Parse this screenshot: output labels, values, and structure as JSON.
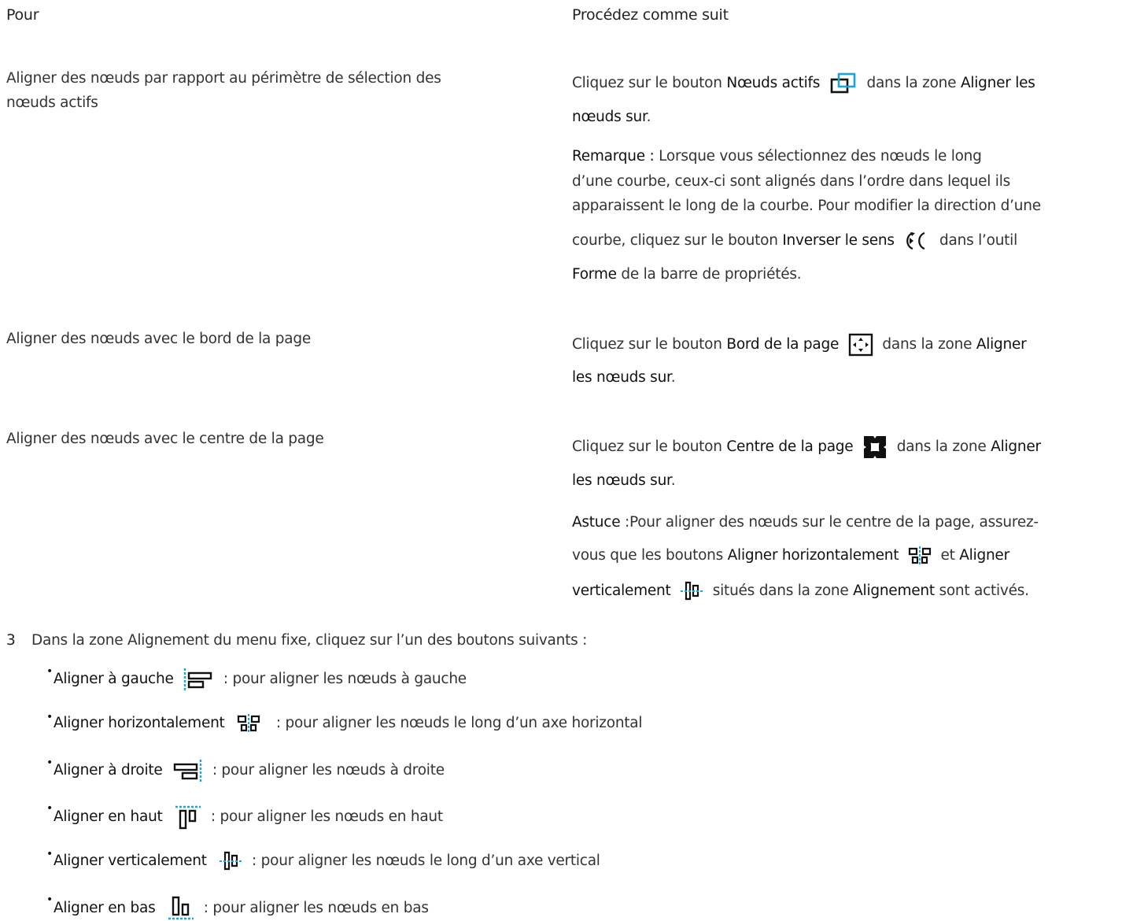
{
  "table": {
    "header_left": "Pour",
    "header_right": "Procédez comme suit",
    "rows": [
      {
        "left_line1": "Aligner des nœuds par rapport au périmètre de sélection des",
        "left_line2": "nœuds actifs",
        "r_click": "Cliquez sur le bouton",
        "r_btn": "Nœuds actifs",
        "r_icon": "active-nodes-icon",
        "r_zone": "dans la zone",
        "r_zone_name_a": "Aligner les",
        "r_zone_name_b": "nœuds sur",
        "r_end": ".",
        "note_label": "Remarque :",
        "note_line1": "Lorsque vous sélectionnez des nœuds le long",
        "note_line2": "d’une courbe, ceux-ci sont alignés dans l’ordre dans lequel ils",
        "note_line3": "apparaissent le long de la courbe. Pour modifier la direction d’une",
        "note_line4a": "courbe, cliquez sur le bouton",
        "note_btn": "Inverser le sens",
        "note_icon": "reverse-direction-icon",
        "note_line4b": "dans l’outil",
        "note_tool": "Forme",
        "note_line5": "de la barre de propriétés."
      },
      {
        "left": "Aligner des nœuds avec le bord de la page",
        "r_click": "Cliquez sur le bouton",
        "r_btn": "Bord de la page",
        "r_icon": "page-edge-icon",
        "r_zone": "dans la zone",
        "r_zone_name_a": "Aligner",
        "r_zone_name_b": "les nœuds sur",
        "r_end": "."
      },
      {
        "left": "Aligner des nœuds avec le centre de la page",
        "r_click": "Cliquez sur le bouton",
        "r_btn": "Centre de la page",
        "r_icon": "page-center-icon",
        "r_zone": "dans la zone",
        "r_zone_name_a": "Aligner",
        "r_zone_name_b": "les nœuds sur",
        "r_end": ".",
        "tip_label": "Astuce",
        "tip_colon": ":",
        "tip_line1": "Pour aligner des nœuds sur le centre de la page, assurez-",
        "tip_line2a": "vous que les boutons",
        "tip_btn1": "Aligner horizontalement",
        "tip_and": "et",
        "tip_btn2a": "Aligner",
        "tip_btn2b": "verticalement",
        "tip_line3a": "situés dans la zone",
        "tip_zone": "Alignement",
        "tip_line3b": "sont activés."
      }
    ]
  },
  "step": {
    "number": "3",
    "text": "Dans la zone Alignement du menu fixe, cliquez sur l’un des boutons suivants :"
  },
  "bullets": [
    {
      "label": "Aligner à gauche",
      "icon": "align-left-icon",
      "desc": ": pour aligner les nœuds à gauche"
    },
    {
      "label": "Aligner horizontalement",
      "icon": "align-horizontal-center-icon",
      "desc": ": pour aligner les nœuds le long d’un axe horizontal"
    },
    {
      "label": "Aligner à droite",
      "icon": "align-right-icon",
      "desc": ": pour aligner les nœuds à droite"
    },
    {
      "label": "Aligner en haut",
      "icon": "align-top-icon",
      "desc": ": pour aligner les nœuds en haut"
    },
    {
      "label": "Aligner verticalement",
      "icon": "align-vertical-center-icon",
      "desc": ": pour aligner les nœuds le long d’un axe vertical"
    },
    {
      "label": "Aligner en bas",
      "icon": "align-bottom-icon",
      "desc": ": pour aligner les nœuds en bas"
    }
  ],
  "colors": {
    "accent_blue": "#1aa3dc",
    "text": "#333333",
    "strong": "#111111"
  }
}
